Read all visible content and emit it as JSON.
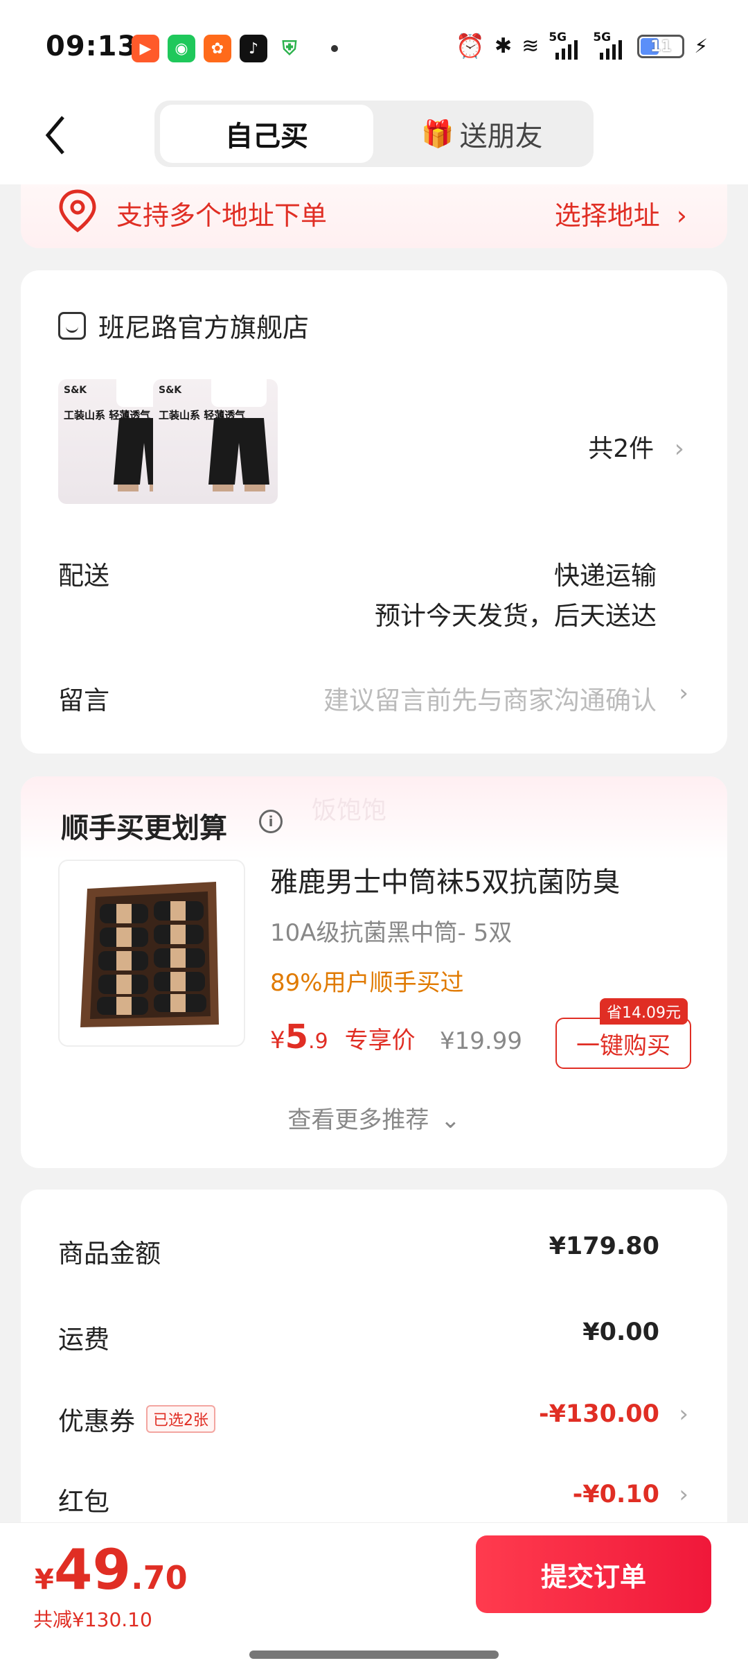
{
  "status_bar": {
    "time": "09:13",
    "battery": "11",
    "network_1": "5G",
    "network_2": "5G"
  },
  "header": {
    "tab_self": "自己买",
    "tab_gift": "送朋友"
  },
  "address": {
    "text": "支持多个地址下单",
    "action": "选择地址"
  },
  "store": {
    "name": "班尼路官方旗舰店",
    "thumb_brand": "S&K",
    "thumb_text": "工装山系 轻薄透气",
    "count": "共2件",
    "delivery_label": "配送",
    "delivery_method": "快递运输",
    "delivery_eta": "预计今天发货，后天送达",
    "message_label": "留言",
    "message_placeholder": "建议留言前先与商家沟通确认"
  },
  "recommend": {
    "title": "顺手买更划算",
    "watermark": "饭饱饱",
    "product_name": "雅鹿男士中筒袜5双抗菌防臭",
    "spec": "10A级抗菌黑中筒- 5双",
    "note": "89%用户顺手买过",
    "price_symbol": "¥",
    "price_int": "5",
    "price_dec": ".9",
    "price_tag": "专享价",
    "old_price": "¥19.99",
    "save_badge": "省14.09元",
    "buy_label": "一键购买",
    "more": "查看更多推荐"
  },
  "summary": {
    "goods_label": "商品金额",
    "goods_value": "¥179.80",
    "shipping_label": "运费",
    "shipping_value": "¥0.00",
    "coupon_label": "优惠券",
    "coupon_badge": "已选2张",
    "coupon_value": "-¥130.00",
    "redpack_label": "红包",
    "redpack_value": "-¥0.10"
  },
  "footer": {
    "pay_symbol": "¥",
    "pay_int": "49",
    "pay_dec": ".70",
    "discount": "共减¥130.10",
    "submit": "提交订单"
  },
  "colors": {
    "accent": "#e02e24",
    "submit_start": "#ff3b4e",
    "submit_end": "#f0183a",
    "note": "#e07a00"
  }
}
